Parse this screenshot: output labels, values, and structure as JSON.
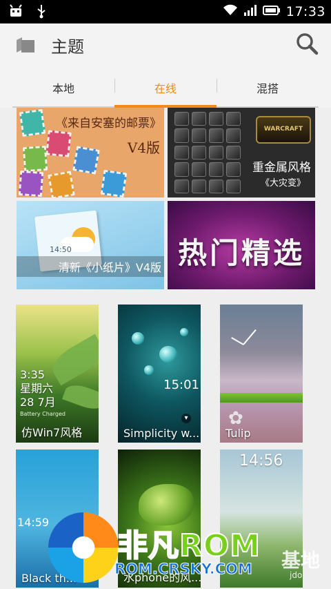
{
  "status_bar": {
    "time": "17:33"
  },
  "title_bar": {
    "title": "主题"
  },
  "tabs": [
    {
      "label": "本地",
      "active": false
    },
    {
      "label": "在线",
      "active": true
    },
    {
      "label": "混搭",
      "active": false
    }
  ],
  "accent_color": "#f08a1c",
  "banners": [
    {
      "line1": "《来自安塞的邮票》",
      "line2": "V4版"
    },
    {
      "logo": "WARCRAFT",
      "line1": "重金属风格",
      "line2": "《大灾变》"
    },
    {
      "clock": "14:50",
      "caption": "清新《小纸片》V4版"
    },
    {
      "title": "热门精选"
    }
  ],
  "themes": [
    {
      "name": "仿Win7风格",
      "lock_time": "3:35",
      "lock_day": "星期六",
      "lock_date": "28 7月",
      "lock_small": "Battery Charged"
    },
    {
      "name": "Simplicity w...",
      "lock_time": "15:01"
    },
    {
      "name": "Tulip"
    },
    {
      "name": "Black th...",
      "lock_time": "14:59"
    },
    {
      "name": "水phone的风..."
    },
    {
      "name": "",
      "lock_time": "14:56"
    }
  ],
  "watermark": {
    "main_a": "非凡",
    "main_b": "ROM",
    "sub": "ROM.CRSKY.COM",
    "site_a": "基地",
    "site_b": "jdo"
  }
}
